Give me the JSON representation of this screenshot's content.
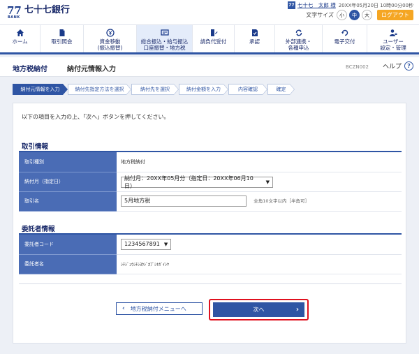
{
  "header": {
    "logo_mark": "77",
    "logo_sub": "BANK",
    "bank_name": "七十七銀行",
    "user_badge": "77",
    "user_name": "七十七　太郎 様",
    "last_login": "20XX年05月20日 10時00分00秒",
    "font_size_label": "文字サイズ",
    "font_sizes": [
      "小",
      "中",
      "大"
    ],
    "font_size_selected": "中",
    "logout_label": "ログアウト"
  },
  "colors": {
    "primary": "#2f55a4",
    "logout": "#f5a623",
    "highlight": "#e0101e"
  },
  "nav": [
    {
      "label": "ホーム",
      "icon": "home-icon"
    },
    {
      "label": "取引照会",
      "icon": "document-icon"
    },
    {
      "label": "資金移動\n(振込振替)",
      "icon": "yen-transfer-icon"
    },
    {
      "label": "総合振込・給与振込\n口座振替・地方税",
      "icon": "payroll-icon",
      "active": true
    },
    {
      "label": "請負代受付",
      "icon": "document-pen-icon"
    },
    {
      "label": "承認",
      "icon": "approval-icon"
    },
    {
      "label": "外部連携・\n各種申込",
      "icon": "sync-icon"
    },
    {
      "label": "電子交付",
      "icon": "refresh-icon"
    },
    {
      "label": "ユーザー\n設定・管理",
      "icon": "user-settings-icon"
    }
  ],
  "page": {
    "title": "地方税納付",
    "subtitle": "納付元情報入力",
    "screen_id": "BCZN002",
    "help_label": "ヘルプ",
    "help_icon": "?"
  },
  "steps": [
    {
      "label": "納付元情報を入力",
      "active": true
    },
    {
      "label": "納付先指定方法を選択"
    },
    {
      "label": "納付先を選択"
    },
    {
      "label": "納付金額を入力"
    },
    {
      "label": "内容確認"
    },
    {
      "label": "確定"
    }
  ],
  "main": {
    "instruction": "以下の項目を入力の上、「次へ」ボタンを押してください。",
    "transaction": {
      "heading": "取引情報",
      "type_label": "取引種別",
      "type_value": "地方税納付",
      "month_label": "納付月（指定日）",
      "month_value": "納付月：20XX年05月分（指定日：20XX年06月10日）",
      "name_label": "取引名",
      "name_value": "5月地方税",
      "name_hint": "全角10文字以内［半角可］"
    },
    "consignor": {
      "heading": "委託者情報",
      "code_label": "委託者コード",
      "code_value": "1234567891",
      "name_label": "委託者名",
      "name_value": "ｼﾁｼﾞｭｳｼﾁｼﾖｳｼﾞｶﾌﾞｼｷｶﾞｲｼﾔ"
    },
    "back_label": "地方税納付メニューへ",
    "next_label": "次へ"
  }
}
